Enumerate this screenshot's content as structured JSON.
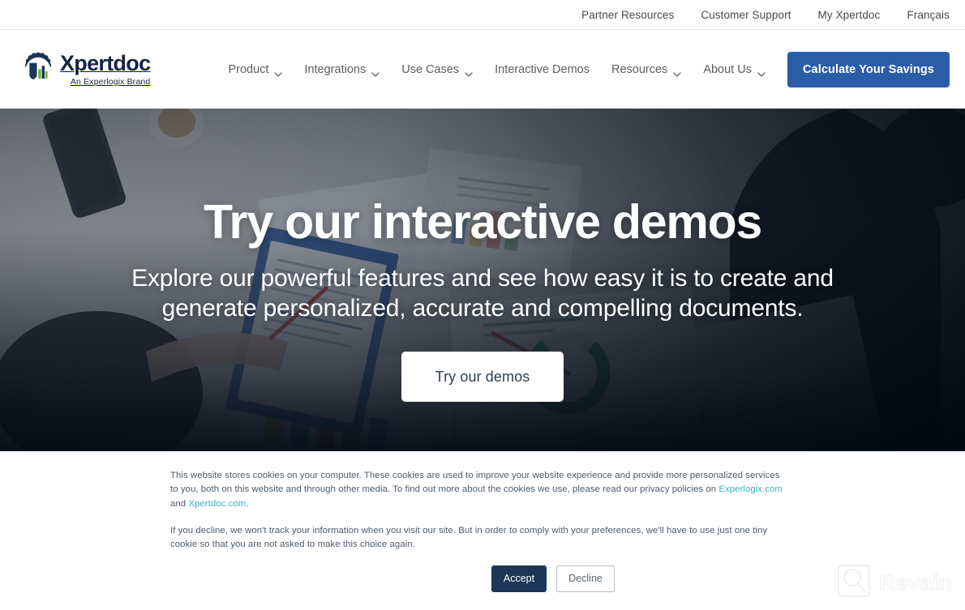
{
  "utility_bar": {
    "links": [
      {
        "label": "Partner Resources"
      },
      {
        "label": "Customer Support"
      },
      {
        "label": "My Xpertdoc"
      },
      {
        "label": "Français"
      }
    ]
  },
  "header": {
    "logo": {
      "word": "Xpertdoc",
      "tagline": "An Experlogix Brand",
      "icon": "gear-bar-chart-logo-icon"
    },
    "nav": [
      {
        "label": "Product",
        "has_dropdown": true,
        "icon": "chevron-down-icon"
      },
      {
        "label": "Integrations",
        "has_dropdown": true,
        "icon": "chevron-down-icon"
      },
      {
        "label": "Use Cases",
        "has_dropdown": true,
        "icon": "chevron-down-icon"
      },
      {
        "label": "Interactive Demos",
        "has_dropdown": false
      },
      {
        "label": "Resources",
        "has_dropdown": true,
        "icon": "chevron-down-icon"
      },
      {
        "label": "About Us",
        "has_dropdown": true,
        "icon": "chevron-down-icon"
      }
    ],
    "cta": {
      "label": "Calculate Your Savings",
      "color": "#2b5ca8"
    }
  },
  "hero": {
    "title": "Try our interactive demos",
    "subtitle": "Explore our powerful features and see how easy it is to create and generate personalized, accurate and compelling documents.",
    "cta_label": "Try our demos",
    "cta_text_color": "#2c3e52",
    "cta_bg_color": "#ffffff"
  },
  "cookie_banner": {
    "paragraph_1_part_1": "This website stores cookies on your computer. These cookies are used to improve your website experience and provide more personalized services to you, both on this website and through other media. To find out more about the cookies we use, please read our privacy policies on ",
    "link_1": "Experlogix.com",
    "paragraph_1_part_2": " and ",
    "link_2": "Xpertdoc.com",
    "paragraph_1_part_3": ".",
    "paragraph_2": "If you decline, we won't track your information when you visit our site. But in order to comply with your preferences, we'll have to use just one tiny cookie so that you are not asked to make this choice again.",
    "accept_label": "Accept",
    "decline_label": "Decline",
    "accept_color": "#1b3656",
    "link_color": "#37b3c4"
  },
  "watermark": {
    "text": "Revain",
    "icon": "revain-magnifier-icon"
  }
}
